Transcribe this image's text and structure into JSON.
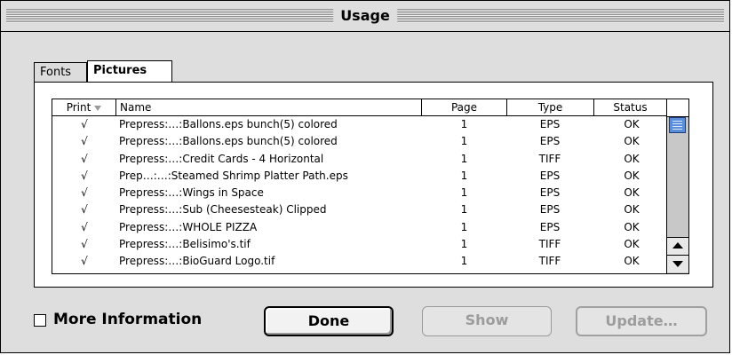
{
  "window": {
    "title": "Usage"
  },
  "tabs": [
    {
      "label": "Fonts",
      "selected": false
    },
    {
      "label": "Pictures",
      "selected": true
    }
  ],
  "table": {
    "columns": [
      "Print",
      "Name",
      "Page",
      "Type",
      "Status"
    ],
    "rows": [
      {
        "print": "√",
        "name": "Prepress:…:Ballons.eps bunch(5) colored",
        "page": "1",
        "type": "EPS",
        "status": "OK"
      },
      {
        "print": "√",
        "name": "Prepress:…:Ballons.eps bunch(5) colored",
        "page": "1",
        "type": "EPS",
        "status": "OK"
      },
      {
        "print": "√",
        "name": "Prepress:…:Credit Cards - 4 Horizontal",
        "page": "1",
        "type": "TIFF",
        "status": "OK"
      },
      {
        "print": "√",
        "name": "Prep…:…:Steamed Shrimp Platter Path.eps",
        "page": "1",
        "type": "EPS",
        "status": "OK"
      },
      {
        "print": "√",
        "name": "Prepress:…:Wings in Space",
        "page": "1",
        "type": "EPS",
        "status": "OK"
      },
      {
        "print": "√",
        "name": "Prepress:…:Sub (Cheesesteak) Clipped",
        "page": "1",
        "type": "EPS",
        "status": "OK"
      },
      {
        "print": "√",
        "name": "Prepress:…:WHOLE PIZZA",
        "page": "1",
        "type": "EPS",
        "status": "OK"
      },
      {
        "print": "√",
        "name": "Prepress:…:Belisimo's.tif",
        "page": "1",
        "type": "TIFF",
        "status": "OK"
      },
      {
        "print": "√",
        "name": "Prepress:…:BioGuard Logo.tif",
        "page": "1",
        "type": "TIFF",
        "status": "OK"
      }
    ]
  },
  "more_information": {
    "label": "More Information",
    "checked": false
  },
  "buttons": {
    "done": "Done",
    "show": "Show",
    "update": "Update…"
  },
  "colors": {
    "scroll_thumb": "#5a8edb",
    "disabled_text": "#9c9c9c"
  }
}
